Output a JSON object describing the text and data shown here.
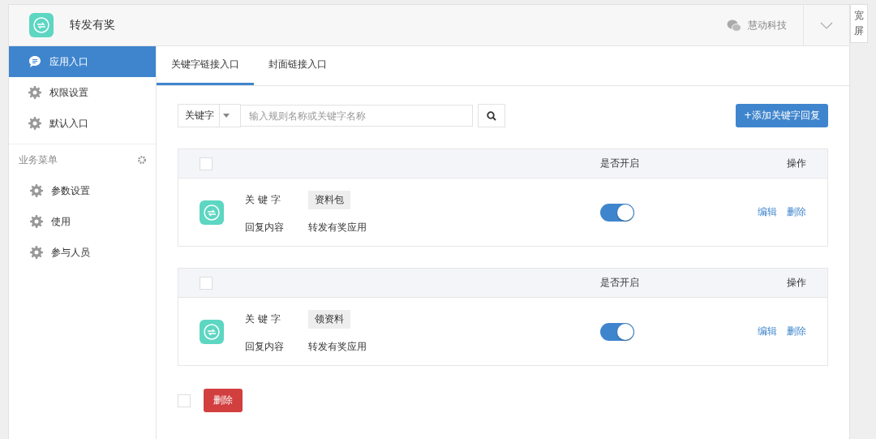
{
  "header": {
    "app_name": "转发有奖",
    "account": "慧动科技",
    "side_tab": "宽屏"
  },
  "sidebar": {
    "items": [
      {
        "label": "应用入口",
        "selected": true
      },
      {
        "label": "权限设置",
        "selected": false
      },
      {
        "label": "默认入口",
        "selected": false
      }
    ],
    "section": {
      "title": "业务菜单",
      "items": [
        {
          "label": "参数设置",
          "selected": false
        },
        {
          "label": "使用",
          "selected": false
        },
        {
          "label": "参与人员",
          "selected": false
        }
      ]
    }
  },
  "tabs": [
    {
      "label": "关键字链接入口",
      "selected": true
    },
    {
      "label": "封面链接入口",
      "selected": false
    }
  ],
  "search": {
    "filter": "关键字",
    "placeholder": "输入规则名称或关键字名称"
  },
  "add_button": "+添加关键字回复",
  "cards": [
    {
      "columns": {
        "enabled": "是否开启",
        "actions": "操作"
      },
      "checked": false,
      "keyword_label": "关 键 字",
      "keyword": "资料包",
      "reply_label": "回复内容",
      "reply": "转发有奖应用",
      "on": true,
      "edit": "编辑",
      "delete": "删除"
    },
    {
      "columns": {
        "enabled": "是否开启",
        "actions": "操作"
      },
      "checked": false,
      "keyword_label": "关 键 字",
      "keyword": "领资料",
      "reply_label": "回复内容",
      "reply": "转发有奖应用",
      "on": true,
      "edit": "编辑",
      "delete": "删除"
    }
  ],
  "footer": {
    "checked": false,
    "delete_button": "删除"
  }
}
